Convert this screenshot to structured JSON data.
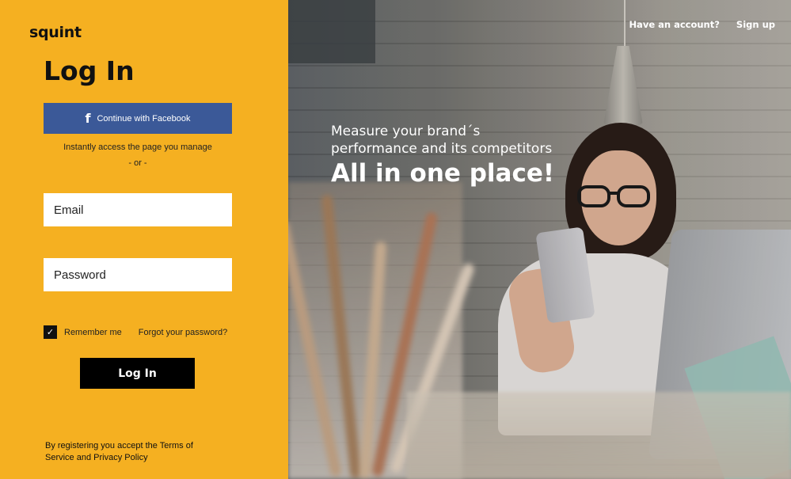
{
  "brand": {
    "logo": "squint"
  },
  "login": {
    "title": "Log In",
    "facebook_label": "Continue with Facebook",
    "facebook_icon": "f",
    "helper_text": "Instantly  access the page you manage",
    "or_text": "-  or -",
    "email_placeholder": "Email",
    "password_placeholder": "Password",
    "remember_label": "Remember me",
    "remember_checked": true,
    "checkmark": "✓",
    "forgot_label": "Forgot your password?",
    "submit_label": "Log In",
    "terms_text": "By registering you accept the Terms of Service and Privacy Policy"
  },
  "nav": {
    "have_account": "Have an account?",
    "signup": "Sign up"
  },
  "hero": {
    "line1": "Measure your brand´s",
    "line2": "performance and its competitors",
    "line3": "All in one place!"
  },
  "colors": {
    "accent": "#f5b021",
    "facebook": "#3b5998",
    "button": "#000000"
  }
}
